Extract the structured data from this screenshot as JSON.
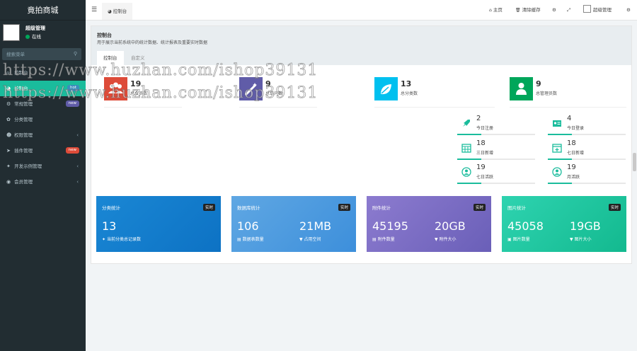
{
  "app": {
    "title": "竟拍商城"
  },
  "user": {
    "name": "超级管理",
    "status": "在线"
  },
  "search": {
    "placeholder": "搜索菜单"
  },
  "sidebar": {
    "items": [
      {
        "label": "控制台",
        "icon": "home-icon"
      },
      {
        "label": "控制台",
        "icon": "dashboard-icon",
        "badge": "hot",
        "badge_color": "#3c8dbc"
      },
      {
        "label": "常规管理",
        "icon": "cogs-icon",
        "badge": "new",
        "badge_color": "#605ca8"
      },
      {
        "label": "分类管理",
        "icon": "leaf-icon"
      },
      {
        "label": "权限管理",
        "icon": "group-icon",
        "chevron": "‹"
      },
      {
        "label": "插件管理",
        "icon": "rocket-icon",
        "badge": "new",
        "badge_color": "#dd4b39"
      },
      {
        "label": "开发示例管理",
        "icon": "magic-icon",
        "chevron": "‹"
      },
      {
        "label": "会员管理",
        "icon": "user-circle-icon",
        "chevron": "‹"
      }
    ]
  },
  "topbar": {
    "tab": "控制台",
    "home": "主页",
    "clear": "清除缓存",
    "admin": "超级管理"
  },
  "panel": {
    "title": "控制台",
    "desc": "用于展示当前系统中的统计数据、统计报表及重要实时数据",
    "tab_active": "控制台",
    "tab_other": "自定义"
  },
  "stats": [
    {
      "num": "19",
      "label": "总会员数",
      "color": "#dd4b39",
      "icon": "users-icon"
    },
    {
      "num": "9",
      "label": "总访问数",
      "color": "#605ca8",
      "icon": "magic-icon"
    },
    {
      "num": "13",
      "label": "总分类数",
      "color": "#00c0ef",
      "icon": "leaf-icon"
    },
    {
      "num": "9",
      "label": "总管理员数",
      "color": "#00a65a",
      "icon": "user-icon"
    }
  ],
  "small_stats": [
    {
      "num": "2",
      "label": "今日注册",
      "icon": "rocket-icon"
    },
    {
      "num": "4",
      "label": "今日登录",
      "icon": "vcard-icon"
    },
    {
      "num": "18",
      "label": "三日新增",
      "icon": "calendar-icon"
    },
    {
      "num": "18",
      "label": "七日新增",
      "icon": "calendar-plus-icon"
    },
    {
      "num": "19",
      "label": "七日活跃",
      "icon": "user-circle-icon"
    },
    {
      "num": "19",
      "label": "月活跃",
      "icon": "user-circle-icon"
    }
  ],
  "cards": [
    {
      "title": "分类统计",
      "tag": "实时",
      "v1": "13",
      "l1": "当前分类总记录数",
      "v2": "",
      "l2": ""
    },
    {
      "title": "数据库统计",
      "tag": "实时",
      "v1": "106",
      "l1": "数据表数量",
      "v2": "21MB",
      "l2": "占用空间"
    },
    {
      "title": "附件统计",
      "tag": "实时",
      "v1": "45195",
      "l1": "附件数量",
      "v2": "20GB",
      "l2": "附件大小"
    },
    {
      "title": "图片统计",
      "tag": "实时",
      "v1": "45058",
      "l1": "图片数量",
      "v2": "19GB",
      "l2": "图片大小"
    }
  ],
  "watermark": "https://www.huzhan.com/ishop39131"
}
